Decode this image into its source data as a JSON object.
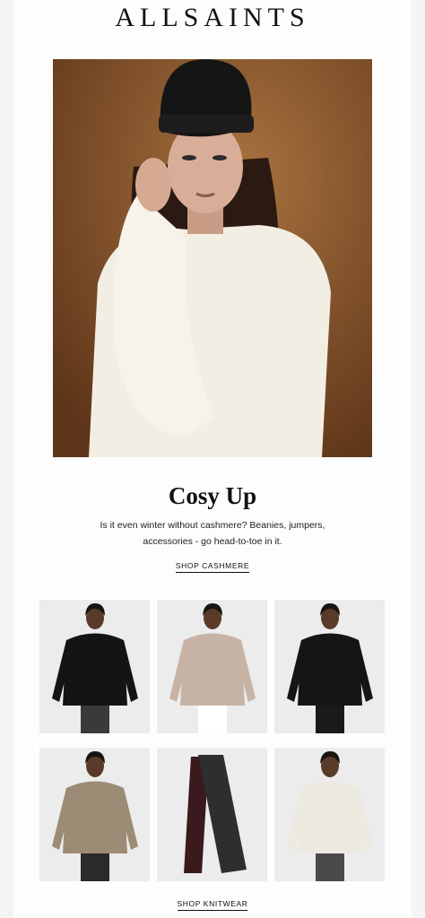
{
  "brand": {
    "logo_text": "ALLSAINTS"
  },
  "hero": {
    "image_alt": "Model in black beanie and cream cashmere jumper"
  },
  "feature": {
    "headline": "Cosy Up",
    "body": "Is it even winter without cashmere? Beanies, jumpers, accessories - go head-to-toe in it.",
    "cta": "SHOP CASHMERE"
  },
  "products": [
    {
      "name": "black-turtleneck-jumper",
      "top": "#141414",
      "bottom": "#3a3a3a"
    },
    {
      "name": "oatmeal-rollneck-jumper",
      "top": "#c7b3a6",
      "bottom": "#ffffff"
    },
    {
      "name": "black-graphic-jumper",
      "top": "#151515",
      "bottom": "#1a1a1a"
    },
    {
      "name": "taupe-funnel-neck-jumper",
      "top": "#9c8c75",
      "bottom": "#2a2a2a"
    },
    {
      "name": "charcoal-cashmere-scarf",
      "top": "#2e2e2e",
      "bottom": "#3a1a1c"
    },
    {
      "name": "ivory-crew-jumper",
      "top": "#ece9e1",
      "bottom": "#4a4a4a"
    }
  ],
  "footer": {
    "cta": "SHOP KNITWEAR"
  }
}
